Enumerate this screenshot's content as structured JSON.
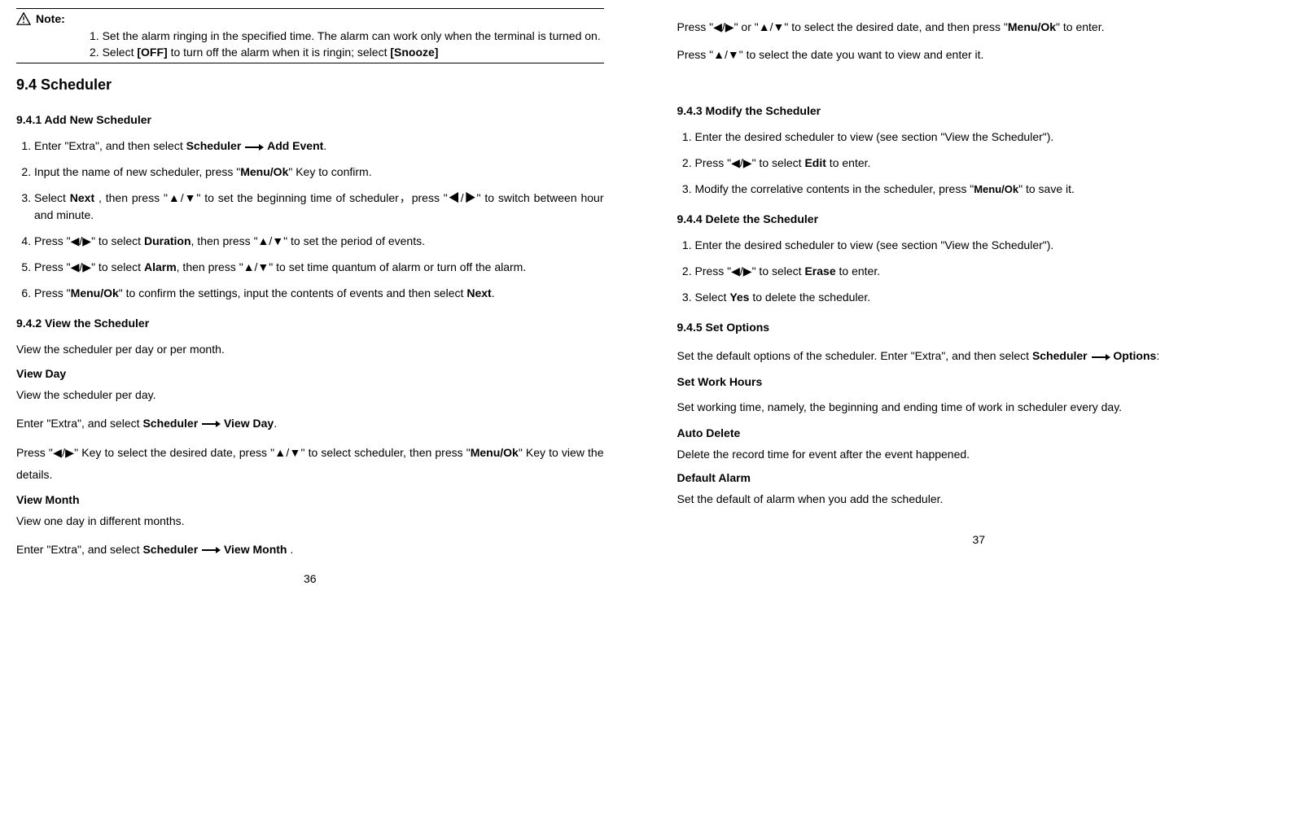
{
  "left": {
    "note_label": "Note:",
    "note_items": [
      "1. Set the alarm ringing in the specified time. The alarm can work only when the terminal is turned on.",
      "2. Select [OFF] to turn off the alarm when it is ringin; select [Snooze]"
    ],
    "h1": "9.4 Scheduler",
    "s941": {
      "title": "9.4.1 Add New Scheduler",
      "step1_a": "Enter \"Extra\", and then select ",
      "step1_b": "Scheduler",
      "step1_c": " Add Event",
      "step1_d": ".",
      "step2_a": "Input the name of new scheduler, press \"",
      "step2_b": "Menu/Ok",
      "step2_c": "\" Key to confirm.",
      "step3_a": "Select ",
      "step3_b": "Next",
      "step3_c": " , then press \"▲/▼\" to set the beginning time of scheduler，press \"◀/▶\" to switch between hour and minute.",
      "step4_a": "Press \"◀/▶\" to select ",
      "step4_b": "Duration",
      "step4_c": ", then press \"▲/▼\" to set the period of events.",
      "step5_a": "Press \"◀/▶\" to select ",
      "step5_b": "Alarm",
      "step5_c": ", then press \"▲/▼\" to set time quantum of alarm or turn off the alarm.",
      "step6_a": "Press \"",
      "step6_b": "Menu/Ok",
      "step6_c": "\" to confirm the settings, input the contents of events and then select ",
      "step6_d": "Next",
      "step6_e": "."
    },
    "s942": {
      "title": "9.4.2 View the Scheduler",
      "p1": "View the scheduler per day or per month.",
      "vd_title": "View Day",
      "vd_p1": "View the scheduler per day.",
      "vd_p2_a": "Enter \"Extra\", and select ",
      "vd_p2_b": "Scheduler",
      "vd_p2_c": " View Day",
      "vd_p2_d": ".",
      "vd_p3_a": "Press \"◀/▶\" Key  to select the desired date, press \"▲/▼\" to select scheduler, then press \"",
      "vd_p3_b": "Menu/Ok",
      "vd_p3_c": "\" Key  to view the details.",
      "vm_title": "View Month",
      "vm_p1": "View one day in different months.",
      "vm_p2_a": "Enter \"Extra\", and select ",
      "vm_p2_b": "Scheduler",
      "vm_p2_c": " View Month",
      "vm_p2_d": " ."
    },
    "pagenum": "36"
  },
  "right": {
    "cont_p1_a": "Press \"◀/▶\"  or  \"▲/▼\" to select the desired date, and then press \"",
    "cont_p1_b": "Menu/Ok",
    "cont_p1_c": "\"  to enter.",
    "cont_p2": "Press \"▲/▼\" to select the date you want to view and enter it.",
    "s943": {
      "title": "9.4.3 Modify the Scheduler",
      "step1": "Enter the desired scheduler to view (see section \"View the Scheduler\").",
      "step2_a": "Press \"◀/▶\" to select ",
      "step2_b": "Edit",
      "step2_c": " to enter.",
      "step3_a": "Modify the correlative contents in the scheduler, press \"",
      "step3_b": "Menu/Ok",
      "step3_c": "\" to save it."
    },
    "s944": {
      "title": "9.4.4 Delete the Scheduler",
      "step1": "Enter the desired scheduler to view (see section \"View the Scheduler\").",
      "step2_a": "Press \"◀/▶\"  to select ",
      "step2_b": "Erase",
      "step2_c": " to enter.",
      "step3_a": "Select ",
      "step3_b": "Yes",
      "step3_c": " to delete the scheduler."
    },
    "s945": {
      "title": "9.4.5 Set Options",
      "p1_a": "Set the default options of the scheduler. Enter \"Extra\", and then select ",
      "p1_b": "Scheduler",
      "p1_c": " Options",
      "p1_d": ":",
      "swh_t": "Set Work Hours",
      "swh_p": "Set working time, namely, the beginning and ending time of work in scheduler every day.",
      "ad_t": "Auto Delete",
      "ad_p": "Delete the record time for event after the event happened.",
      "da_t": "Default Alarm",
      "da_p": "Set the default of alarm when you add the scheduler."
    },
    "pagenum": "37"
  }
}
